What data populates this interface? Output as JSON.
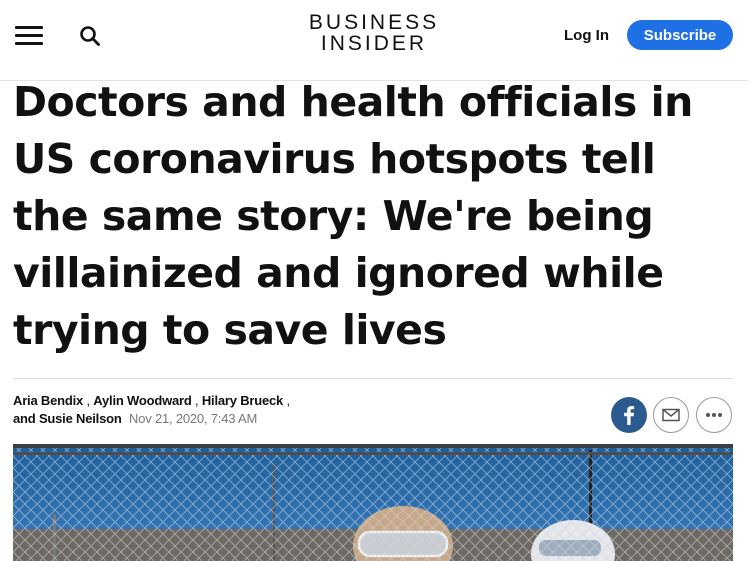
{
  "header": {
    "logo_line1": "BUSINESS",
    "logo_line2": "INSIDER",
    "login_label": "Log In",
    "subscribe_label": "Subscribe",
    "menu_icon": "hamburger-menu-icon",
    "search_icon": "search-icon",
    "accent_color": "#1f6fe5"
  },
  "article": {
    "headline": "Doctors and health officials in US coronavirus hotspots tell the same story: We're being villainized and ignored while trying to save lives",
    "authors": [
      "Aria Bendix",
      "Aylin Woodward",
      "Hilary Brueck"
    ],
    "last_author_prefix": "and",
    "last_author": "Susie Neilson",
    "date": "Nov 21, 2020, 7:43 AM"
  },
  "share": {
    "facebook_icon": "facebook-icon",
    "email_icon": "email-icon",
    "more_icon": "more-options-icon",
    "facebook_color": "#2a5a8f"
  }
}
